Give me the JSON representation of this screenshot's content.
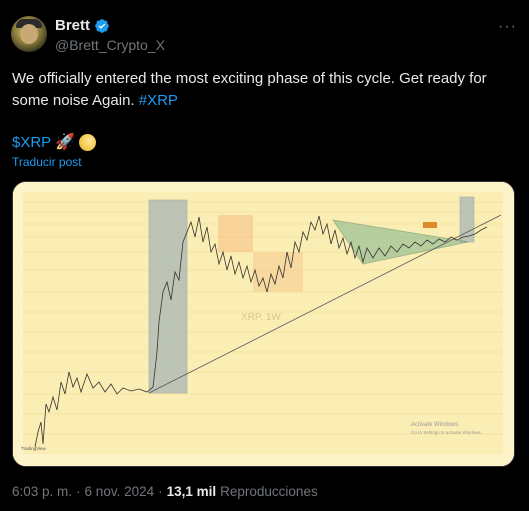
{
  "author": {
    "name": "Brett",
    "handle": "@Brett_Crypto_X",
    "avatar_icon": "user-avatar",
    "verified_icon": "verified-badge-icon",
    "verified_color": "#1d9bf0"
  },
  "more_icon": "more-icon",
  "tweet": {
    "text": "We officially entered the most exciting phase of this cycle. Get ready for some noise Again.",
    "hashtag": "#XRP",
    "cashtag": "$XRP",
    "emojis": [
      "rocket-icon",
      "moon-icon"
    ],
    "translate_label": "Traducir post"
  },
  "media": {
    "watermark": "XRP, 1W",
    "activate_title": "Activate Windows",
    "activate_sub": "Go to Settings to activate Windows.",
    "logo_text": "TradingView"
  },
  "meta": {
    "time": "6:03 p. m.",
    "separator": "·",
    "date": "6 nov. 2024",
    "views_count": "13,1 mil",
    "views_label": "Reproducciones"
  },
  "colors": {
    "background": "#000000",
    "accent": "#1d9bf0",
    "secondary_text": "#71767b",
    "chart_background": "#fbeeb4"
  }
}
